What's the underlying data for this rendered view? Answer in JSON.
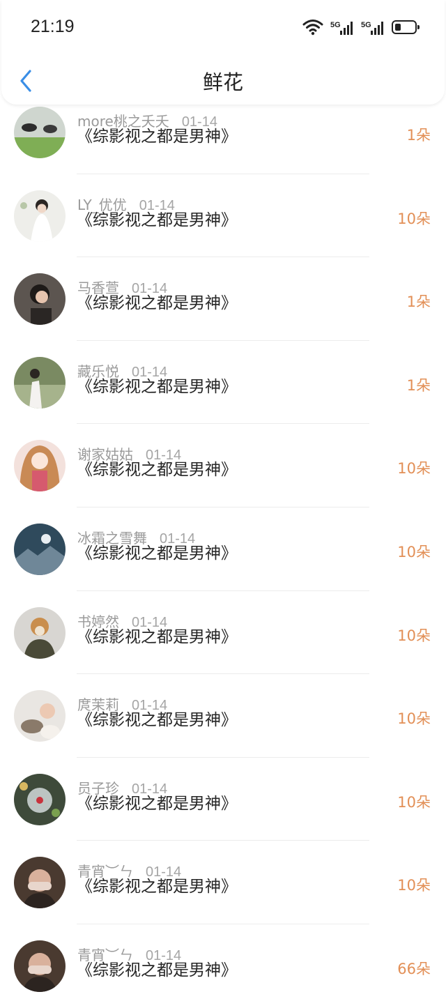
{
  "status_bar": {
    "time": "21:19",
    "icons": [
      "wifi-icon",
      "5g-signal-icon",
      "5g-signal-icon",
      "battery-icon"
    ]
  },
  "nav": {
    "title": "鲜花",
    "back_icon": "chevron-left-icon"
  },
  "colors": {
    "accent_back": "#3a8ee6",
    "count_orange": "#e28f56",
    "meta_gray": "#9a9a9a"
  },
  "items": [
    {
      "user": "more桃之夭夭",
      "date": "01-14",
      "book": "《综影视之都是男神》",
      "count": "1朵"
    },
    {
      "user": "LY_优优",
      "date": "01-14",
      "book": "《综影视之都是男神》",
      "count": "10朵"
    },
    {
      "user": "马香萱",
      "date": "01-14",
      "book": "《综影视之都是男神》",
      "count": "1朵"
    },
    {
      "user": "藏乐悦",
      "date": "01-14",
      "book": "《综影视之都是男神》",
      "count": "1朵"
    },
    {
      "user": "谢家姑姑",
      "date": "01-14",
      "book": "《综影视之都是男神》",
      "count": "10朵"
    },
    {
      "user": "冰霜之雪舞",
      "date": "01-14",
      "book": "《综影视之都是男神》",
      "count": "10朵"
    },
    {
      "user": "书婷然",
      "date": "01-14",
      "book": "《综影视之都是男神》",
      "count": "10朵"
    },
    {
      "user": "庹茉莉",
      "date": "01-14",
      "book": "《综影视之都是男神》",
      "count": "10朵"
    },
    {
      "user": "员子珍",
      "date": "01-14",
      "book": "《综影视之都是男神》",
      "count": "10朵"
    },
    {
      "user": "青宵︶ㄣ",
      "date": "01-14",
      "book": "《综影视之都是男神》",
      "count": "10朵"
    },
    {
      "user": "青宵︶ㄣ",
      "date": "01-14",
      "book": "《综影视之都是男神》",
      "count": "66朵"
    }
  ]
}
